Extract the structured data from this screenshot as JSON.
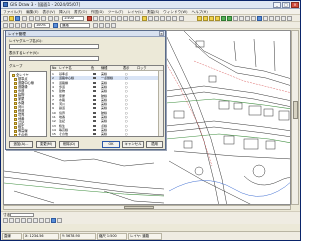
{
  "window": {
    "title": "GIS Draw 3 - [図面1 - 2024/05/07]",
    "controls": [
      "_",
      "□",
      "×"
    ]
  },
  "menubar": {
    "items": [
      "ファイル(F)",
      "編集(E)",
      "表示(V)",
      "挿入(I)",
      "書式(O)",
      "作図(D)",
      "ツール(T)",
      "レイヤ(L)",
      "測量(S)",
      "ウィンドウ(W)",
      "ヘルプ(H)"
    ]
  },
  "toolbar": {
    "scale_value": "1:500",
    "zoom_value": "100%",
    "layer_value": "道路"
  },
  "dialog": {
    "title": "レイヤ管理",
    "close": "×",
    "row1_label": "レイヤグループ名(G)：",
    "row2_label": "表示するレイヤ(V)：",
    "row3_label": "グループ",
    "tree_nodes": [
      "全レイヤ",
      "基準点",
      "道路中心線",
      "道路縁",
      "歩道",
      "建物",
      "家屋",
      "水路",
      "河川",
      "鉄道",
      "境界",
      "地番",
      "注記",
      "植生",
      "等高線",
      "その他"
    ],
    "list_headers": [
      "No",
      "レイヤ名",
      "色",
      "線種",
      "表示",
      "ロック"
    ],
    "list_rows": [
      {
        "no": "1",
        "name": "基準点",
        "color": "#000000",
        "line": "実線",
        "show": "○",
        "lock": ""
      },
      {
        "no": "2",
        "name": "道路中心線",
        "color": "#d23c3c",
        "line": "一点鎖線",
        "show": "○",
        "lock": ""
      },
      {
        "no": "3",
        "name": "道路縁",
        "color": "#000000",
        "line": "実線",
        "show": "○",
        "lock": ""
      },
      {
        "no": "4",
        "name": "歩道",
        "color": "#3c8c3c",
        "line": "実線",
        "show": "○",
        "lock": ""
      },
      {
        "no": "5",
        "name": "建物",
        "color": "#000000",
        "line": "実線",
        "show": "○",
        "lock": ""
      },
      {
        "no": "6",
        "name": "家屋",
        "color": "#d23c3c",
        "line": "破線",
        "show": "○",
        "lock": ""
      },
      {
        "no": "7",
        "name": "水路",
        "color": "#3c6cd2",
        "line": "実線",
        "show": "○",
        "lock": ""
      },
      {
        "no": "8",
        "name": "河川",
        "color": "#3c6cd2",
        "line": "実線",
        "show": "○",
        "lock": ""
      },
      {
        "no": "9",
        "name": "鉄道",
        "color": "#000000",
        "line": "実線",
        "show": "○",
        "lock": ""
      },
      {
        "no": "10",
        "name": "境界",
        "color": "#d23c3c",
        "line": "破線",
        "show": "○",
        "lock": ""
      },
      {
        "no": "11",
        "name": "地番",
        "color": "#000000",
        "line": "実線",
        "show": "○",
        "lock": ""
      },
      {
        "no": "12",
        "name": "注記",
        "color": "#000000",
        "line": "実線",
        "show": "○",
        "lock": ""
      },
      {
        "no": "13",
        "name": "植生",
        "color": "#3c8c3c",
        "line": "点線",
        "show": "○",
        "lock": ""
      },
      {
        "no": "14",
        "name": "等高線",
        "color": "#8c5a2a",
        "line": "実線",
        "show": "○",
        "lock": ""
      },
      {
        "no": "15",
        "name": "その他",
        "color": "#000000",
        "line": "実線",
        "show": "○",
        "lock": ""
      }
    ],
    "buttons": {
      "add": "追加(A)...",
      "edit": "変更(M)",
      "delete": "削除(D)",
      "ok": "OK",
      "cancel": "キャンセル",
      "apply": "適用"
    }
  },
  "cmdbar": {
    "label": "寸法:"
  },
  "statusbar": {
    "cells": [
      "直線",
      "X: 1234.56",
      "Y: 5678.90",
      "縮尺 1:500",
      "レイヤ: 道路"
    ]
  },
  "colors": {
    "accent": "#3a6fc2",
    "map_line": "#333333",
    "road_line": "#3c8c3c"
  }
}
